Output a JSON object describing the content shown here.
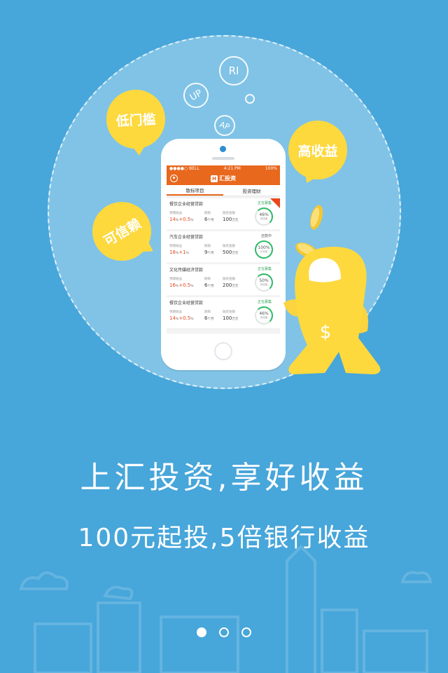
{
  "bubbles": {
    "low": "低门槛",
    "high": "高收益",
    "trust": "可信赖",
    "ri": "RI",
    "up": "UP",
    "ap": "AP"
  },
  "phone": {
    "status_left": "●●●●○ BELL",
    "status_time": "4:21 PM",
    "status_right": "100%",
    "app_title": "汇投资",
    "tabs": [
      "散标项目",
      "投资理财"
    ],
    "loans": [
      {
        "name": "餐饮企业经营贷款",
        "state": "正在募集",
        "labels": [
          "预期收益",
          "期限",
          "融资金额"
        ],
        "rate": "14",
        "bonus": "0.5",
        "period": "6",
        "period_unit": "个月",
        "amount": "100",
        "amount_unit": "万元",
        "progress": "46%",
        "progress_label": "完成度",
        "flag": true
      },
      {
        "name": "汽车企业经营贷款",
        "state": "还款中",
        "labels": [
          "预期收益",
          "期限",
          "融资金额"
        ],
        "rate": "18",
        "bonus": "1",
        "period": "9",
        "period_unit": "个月",
        "amount": "500",
        "amount_unit": "万元",
        "progress": "100%",
        "progress_label": "已完成",
        "flag": false
      },
      {
        "name": "文化传媒经济贷款",
        "state": "正在募集",
        "labels": [
          "预期收益",
          "期限",
          "融资金额"
        ],
        "rate": "16",
        "bonus": "0.5",
        "period": "6",
        "period_unit": "个月",
        "amount": "200",
        "amount_unit": "万元",
        "progress": "50%",
        "progress_label": "完成度",
        "flag": false
      },
      {
        "name": "餐饮企业经营贷款",
        "state": "正在募集",
        "labels": [
          "预期收益",
          "期限",
          "融资金额"
        ],
        "rate": "14",
        "bonus": "0.5",
        "period": "6",
        "period_unit": "个月",
        "amount": "100",
        "amount_unit": "万元",
        "progress": "46%",
        "progress_label": "完成度",
        "flag": false
      }
    ]
  },
  "headline": "上汇投资,享好收益",
  "subheadline": "100元起投,5倍银行收益",
  "pager": {
    "count": 3,
    "active": 0
  },
  "colors": {
    "background": "#47a6da",
    "accent": "#e8681d",
    "bubble": "#fdd93e",
    "progress": "#2dbb66"
  }
}
